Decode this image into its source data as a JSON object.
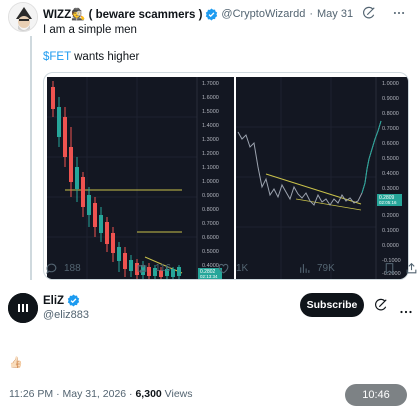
{
  "quoted_tweet": {
    "author_name": "WIZZ🕵 ( beware scammers )",
    "handle": "@CryptoWizardd",
    "date": "May 31",
    "line1": "I am a simple men",
    "cashtag": "$FET",
    "line2_rest": " wants higher",
    "chart_left": {
      "price_labels": [
        "1.7000",
        "1.6000",
        "1.5000",
        "1.4000",
        "1.3000",
        "1.2000",
        "1.1000",
        "1.0000",
        "0.9000",
        "0.8000",
        "0.7000",
        "0.6000",
        "0.5000",
        "0.4000"
      ],
      "current_price_tag": "0.2802",
      "current_time_tag": "02:13:34"
    },
    "chart_right": {
      "price_labels": [
        "1.0000",
        "0.9000",
        "0.8000",
        "0.7000",
        "0.6000",
        "0.5000",
        "0.4000",
        "0.3000",
        "0.2000",
        "0.1000",
        "0.0000",
        "-0.1000",
        "-0.2000",
        "-0.3000"
      ],
      "current_price_tag": "0.2809",
      "current_time_tag": "02:05:16"
    },
    "stats": {
      "replies": "188",
      "reposts": "116",
      "likes": "1K",
      "views": "79K"
    }
  },
  "reply": {
    "author_name": "EliZ",
    "handle": "@eliz883",
    "subscribe_label": "Subscribe",
    "emoji": "👍🏻",
    "time": "11:26 PM · May 31, 2026",
    "views_count": "6,300",
    "views_label": "Views"
  },
  "status_clock": "10:46",
  "colors": {
    "verified_blue": "#1d9bf0",
    "chart_bg": "#131722",
    "candle_up": "#26a69a",
    "candle_down": "#ef5350",
    "support_line": "#c9c24a",
    "price_tag": "#26a69a"
  }
}
